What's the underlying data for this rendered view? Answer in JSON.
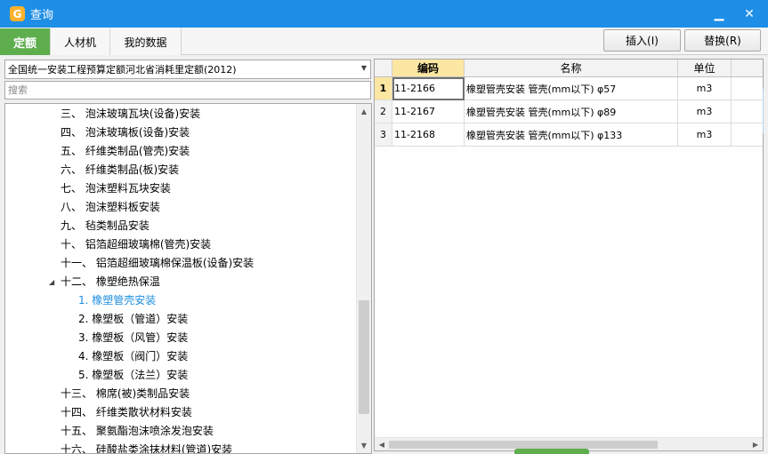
{
  "window": {
    "title": "查询",
    "icon": "app-logo-icon"
  },
  "tabs": [
    {
      "label": "定额",
      "active": true
    },
    {
      "label": "人材机",
      "active": false
    },
    {
      "label": "我的数据",
      "active": false
    }
  ],
  "toolbar": {
    "insert_label": "插入(I)",
    "replace_label": "替换(R)"
  },
  "left": {
    "library_selected": "全国统一安装工程预算定额河北省消耗里定额(2012)",
    "search_placeholder": "搜索",
    "tree": [
      {
        "label": "三、 泡沫玻璃瓦块(设备)安装",
        "level": 1
      },
      {
        "label": "四、 泡沫玻璃板(设备)安装",
        "level": 1
      },
      {
        "label": "五、 纤维类制品(管壳)安装",
        "level": 1
      },
      {
        "label": "六、 纤维类制品(板)安装",
        "level": 1
      },
      {
        "label": "七、 泡沫塑料瓦块安装",
        "level": 1
      },
      {
        "label": "八、 泡沫塑料板安装",
        "level": 1
      },
      {
        "label": "九、 毡类制品安装",
        "level": 1
      },
      {
        "label": "十、 铝箔超细玻璃棉(管壳)安装",
        "level": 1
      },
      {
        "label": "十一、 铝箔超细玻璃棉保温板(设备)安装",
        "level": 1
      },
      {
        "label": "十二、 橡塑绝热保温",
        "level": 1,
        "expanded": true
      },
      {
        "label": "1. 橡塑管壳安装",
        "level": 2,
        "selected": true
      },
      {
        "label": "2. 橡塑板（管道）安装",
        "level": 2
      },
      {
        "label": "3. 橡塑板（风管）安装",
        "level": 2
      },
      {
        "label": "4. 橡塑板（阀门）安装",
        "level": 2
      },
      {
        "label": "5. 橡塑板（法兰）安装",
        "level": 2
      },
      {
        "label": "十三、 棉席(被)类制品安装",
        "level": 1
      },
      {
        "label": "十四、 纤维类散状材料安装",
        "level": 1
      },
      {
        "label": "十五、 聚氨酯泡沫喷涂发泡安装",
        "level": 1
      },
      {
        "label": "十六、 硅酸盐类涂抹材料(管道)安装",
        "level": 1
      }
    ]
  },
  "grid": {
    "headers": {
      "code": "编码",
      "name": "名称",
      "unit": "单位"
    },
    "rows": [
      {
        "num": "1",
        "code": "11-2166",
        "name": "橡塑管壳安装 管壳(mm以下) φ57",
        "unit": "m3"
      },
      {
        "num": "2",
        "code": "11-2167",
        "name": "橡塑管壳安装 管壳(mm以下) φ89",
        "unit": "m3"
      },
      {
        "num": "3",
        "code": "11-2168",
        "name": "橡塑管壳安装 管壳(mm以下) φ133",
        "unit": "m3"
      }
    ]
  },
  "colors": {
    "titlebar": "#1e8ee6",
    "active_tab": "#5fae4e",
    "selected_tree_item": "#1e90e0",
    "header_highlight": "#fce7a2"
  }
}
